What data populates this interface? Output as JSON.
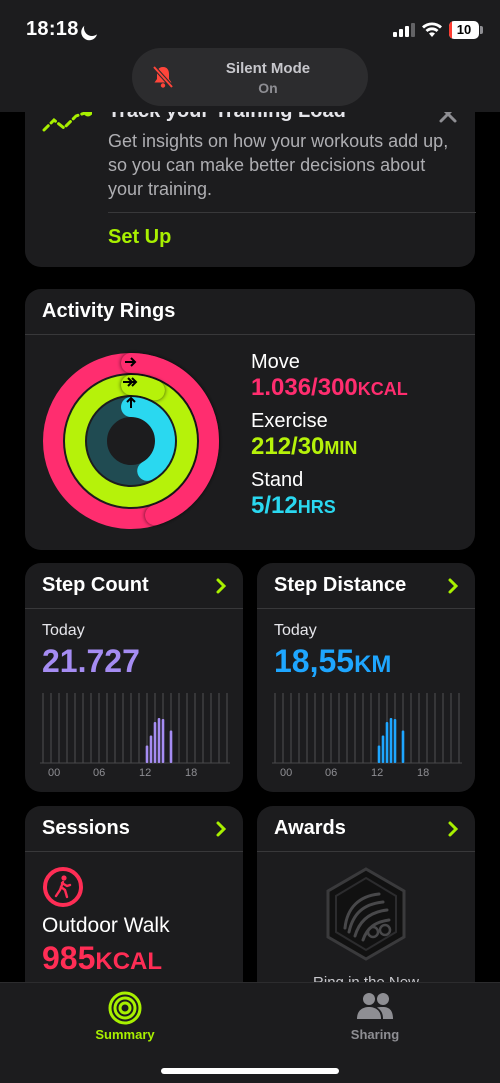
{
  "status": {
    "time": "18:18",
    "battery": "10",
    "battery_level": 0.1,
    "battery_color": "#ff3b30"
  },
  "notification": {
    "title": "Silent Mode",
    "subtitle": "On",
    "icon": "bell-slash-icon"
  },
  "training_load": {
    "title": "Track your Training Load",
    "description": "Get insights on how your workouts add up, so you can make better decisions about your training.",
    "action": "Set Up",
    "icon": "training-load-icon"
  },
  "activity_rings": {
    "title": "Activity Rings",
    "move": {
      "label": "Move",
      "value": "1.036/300",
      "unit": "KCAL",
      "color": "#ff2d6f",
      "progress": 3.45
    },
    "exercise": {
      "label": "Exercise",
      "value": "212/30",
      "unit": "MIN",
      "color": "#b6f20a",
      "progress": 7.07
    },
    "stand": {
      "label": "Stand",
      "value": "5/12",
      "unit": "HRS",
      "color": "#2ad8f0",
      "progress": 0.42
    }
  },
  "step_count": {
    "title": "Step Count",
    "period": "Today",
    "value": "21.727",
    "color": "#a58cf2",
    "axis": [
      "00",
      "06",
      "12",
      "18"
    ]
  },
  "step_distance": {
    "title": "Step Distance",
    "period": "Today",
    "value": "18,55",
    "unit": "KM",
    "color": "#1ea6ff",
    "axis": [
      "00",
      "06",
      "12",
      "18"
    ]
  },
  "sessions": {
    "title": "Sessions",
    "name": "Outdoor Walk",
    "value": "985",
    "unit": "KCAL",
    "icon": "walking-icon"
  },
  "awards": {
    "title": "Awards",
    "badge_text": "Ring in the New",
    "icon": "award-badge-icon"
  },
  "tabs": [
    {
      "label": "Summary",
      "icon": "summary-rings-icon",
      "active": true
    },
    {
      "label": "Sharing",
      "icon": "sharing-people-icon",
      "active": false
    }
  ],
  "colors": {
    "accent": "#a8f000",
    "card": "#1c1c1e",
    "background": "#000000"
  }
}
